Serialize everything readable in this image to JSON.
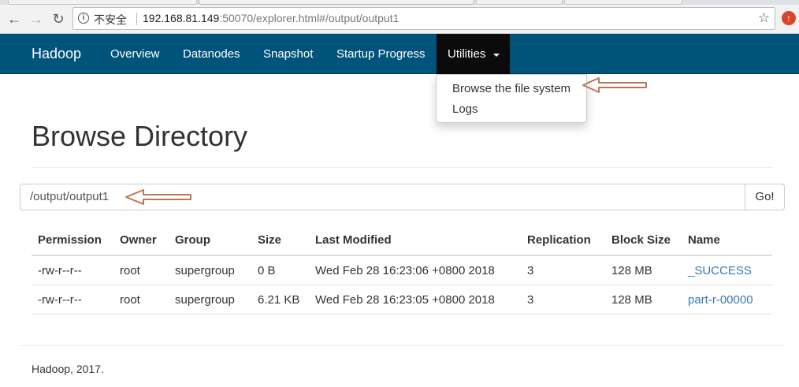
{
  "browser": {
    "security_label": "不安全",
    "url_host": "192.168.81.149",
    "url_rest": ":50070/explorer.html#/output/output1"
  },
  "navbar": {
    "brand": "Hadoop",
    "items": [
      "Overview",
      "Datanodes",
      "Snapshot",
      "Startup Progress"
    ],
    "utilities_label": "Utilities"
  },
  "dropdown": {
    "items": [
      "Browse the file system",
      "Logs"
    ]
  },
  "page": {
    "title": "Browse Directory",
    "path_value": "/output/output1",
    "go_label": "Go!"
  },
  "table": {
    "headers": [
      "Permission",
      "Owner",
      "Group",
      "Size",
      "Last Modified",
      "Replication",
      "Block Size",
      "Name"
    ],
    "rows": [
      [
        "-rw-r--r--",
        "root",
        "supergroup",
        "0 B",
        "Wed Feb 28 16:23:06 +0800 2018",
        "3",
        "128 MB",
        "_SUCCESS"
      ],
      [
        "-rw-r--r--",
        "root",
        "supergroup",
        "6.21 KB",
        "Wed Feb 28 16:23:05 +0800 2018",
        "3",
        "128 MB",
        "part-r-00000"
      ]
    ]
  },
  "footer": {
    "text": "Hadoop, 2017."
  },
  "icons": {
    "back": "back-arrow-icon",
    "forward": "forward-arrow-icon",
    "reload": "reload-icon",
    "info": "info-icon",
    "star": "star-icon",
    "extension": "extension-icon"
  },
  "colors": {
    "navbar": "#00537a",
    "navbar_active": "#0b0b0b",
    "link": "#337ab7",
    "annotation_arrow": "#b57a57"
  }
}
